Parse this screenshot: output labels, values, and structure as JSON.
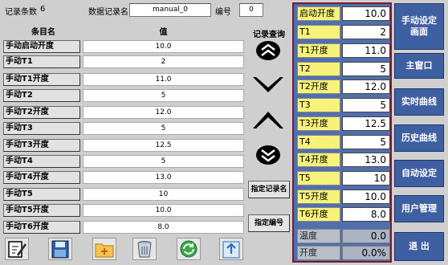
{
  "header": {
    "record_count_label": "记录条数",
    "record_count_value": "6",
    "record_name_label": "数据记录名",
    "record_name_value": "manual_0",
    "number_label": "编号",
    "number_value": "0"
  },
  "table": {
    "col_name": "条目名",
    "col_value": "值",
    "rows": [
      {
        "name": "手动启动开度",
        "value": "10.0"
      },
      {
        "name": "手动T1",
        "value": "2"
      },
      {
        "name": "手动T1开度",
        "value": "11.0"
      },
      {
        "name": "手动T2",
        "value": "5"
      },
      {
        "name": "手动T2开度",
        "value": "12.0"
      },
      {
        "name": "手动T3",
        "value": "5"
      },
      {
        "name": "手动T3开度",
        "value": "12.5"
      },
      {
        "name": "手动T4",
        "value": "5"
      },
      {
        "name": "手动T4开度",
        "value": "13.0"
      },
      {
        "name": "手动T5",
        "value": "10"
      },
      {
        "name": "手动T5开度",
        "value": "10.0"
      },
      {
        "name": "手动T6开度",
        "value": "8.0"
      }
    ]
  },
  "query": {
    "title": "记录查询",
    "assign_name_label": "指定记录名",
    "assign_number_label": "指定编号"
  },
  "params": [
    {
      "label": "启动开度",
      "value": "10.0"
    },
    {
      "label": "T1",
      "value": "2"
    },
    {
      "label": "T1开度",
      "value": "11.0"
    },
    {
      "label": "T2",
      "value": "5"
    },
    {
      "label": "T2开度",
      "value": "12.0"
    },
    {
      "label": "T3",
      "value": "5"
    },
    {
      "label": "T3开度",
      "value": "12.5"
    },
    {
      "label": "T4",
      "value": "5"
    },
    {
      "label": "T4开度",
      "value": "13.0"
    },
    {
      "label": "T5",
      "value": "10"
    },
    {
      "label": "T5开度",
      "value": "10.0"
    },
    {
      "label": "T6开度",
      "value": "8.0"
    }
  ],
  "status": [
    {
      "label": "温度",
      "value": "0.0"
    },
    {
      "label": "开度",
      "value": "0.0%"
    }
  ],
  "nav": {
    "manual_setting": "手动设定画面",
    "main_window": "主窗口",
    "realtime_curve": "实时曲线",
    "history_curve": "历史曲线",
    "auto_setting": "自动设定",
    "user_mgmt": "用户管理",
    "exit": "退 出"
  },
  "colors": {
    "panel_bg": "#4f6fae",
    "panel_border": "#7a1a2a",
    "param_label_bg": "#f6f27a",
    "nav_bg": "#3f5fa3"
  }
}
